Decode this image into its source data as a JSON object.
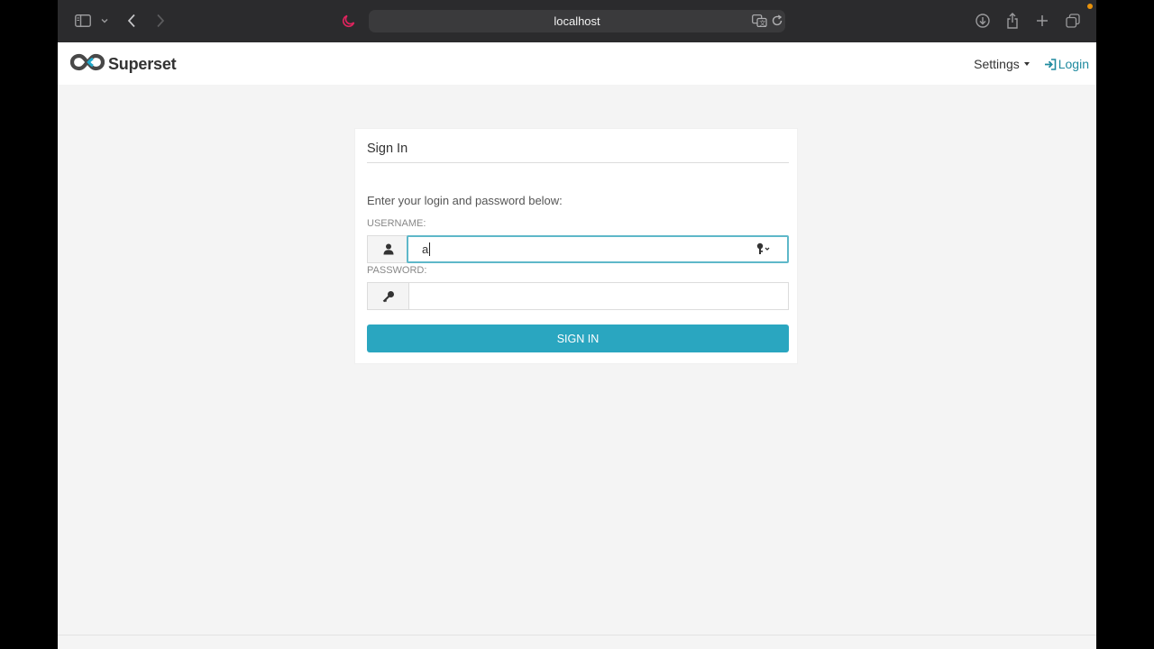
{
  "browser": {
    "url": "localhost"
  },
  "navbar": {
    "brand": "Superset",
    "settings_label": "Settings",
    "login_label": "Login"
  },
  "login_form": {
    "title": "Sign In",
    "instructions": "Enter your login and password below:",
    "username_label": "USERNAME:",
    "username_value": "a",
    "password_label": "PASSWORD:",
    "password_value": "",
    "submit_label": "SIGN IN"
  },
  "colors": {
    "accent": "#2aa6c0",
    "link": "#1f8a9f",
    "focus_border": "#5eb8c9",
    "night_mode_icon": "#e0245e"
  },
  "icons": [
    "sidebar-icon",
    "chevron-down-icon",
    "back-icon",
    "forward-icon",
    "night-mode-icon",
    "translate-icon",
    "reload-icon",
    "download-icon",
    "share-icon",
    "new-tab-icon",
    "tabs-overview-icon",
    "superset-logo-icon",
    "login-icon",
    "user-icon",
    "key-icon",
    "password-key-icon"
  ]
}
